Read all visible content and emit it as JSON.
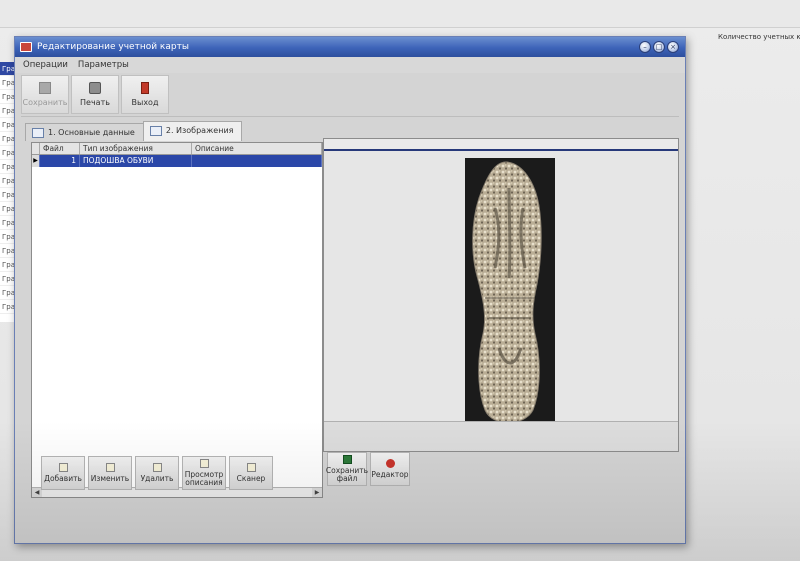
{
  "background_app": {
    "count_label": "Количество учетных карт:",
    "list_items": [
      "Гра",
      "Гра",
      "Гра",
      "Гра",
      "Гра",
      "Гра",
      "Гра",
      "Гра",
      "Гра",
      "Гра",
      "Гра",
      "Гра",
      "Гра",
      "Гра",
      "Гра",
      "Гра",
      "Гра",
      "Гра"
    ]
  },
  "window": {
    "title": "Редактирование учетной карты",
    "menu": [
      "Операции",
      "Параметры"
    ],
    "toolbar": {
      "save_label": "Сохранить",
      "print_label": "Печать",
      "exit_label": "Выход"
    },
    "tabs": [
      {
        "label": "1. Основные данные",
        "active": false
      },
      {
        "label": "2. Изображения",
        "active": true
      }
    ]
  },
  "images_grid": {
    "columns": [
      "Файл",
      "Тип изображения",
      "Описание"
    ],
    "rows": [
      {
        "file": "1",
        "type": "ПОДОШВА ОБУВИ",
        "description": ""
      }
    ]
  },
  "left_actions": {
    "add_label": "Добавить",
    "edit_label": "Изменить",
    "delete_label": "Удалить",
    "view_desc_label_1": "Просмотр",
    "view_desc_label_2": "описания",
    "scan_label": "Сканер"
  },
  "right_actions": {
    "save_file_label_1": "Сохранить",
    "save_file_label_2": "файл",
    "editor_label": "Редактор"
  },
  "colors": {
    "title_bar": "#3d63b8",
    "selection": "#2b47a8",
    "image_background": "#1b1b1b"
  }
}
